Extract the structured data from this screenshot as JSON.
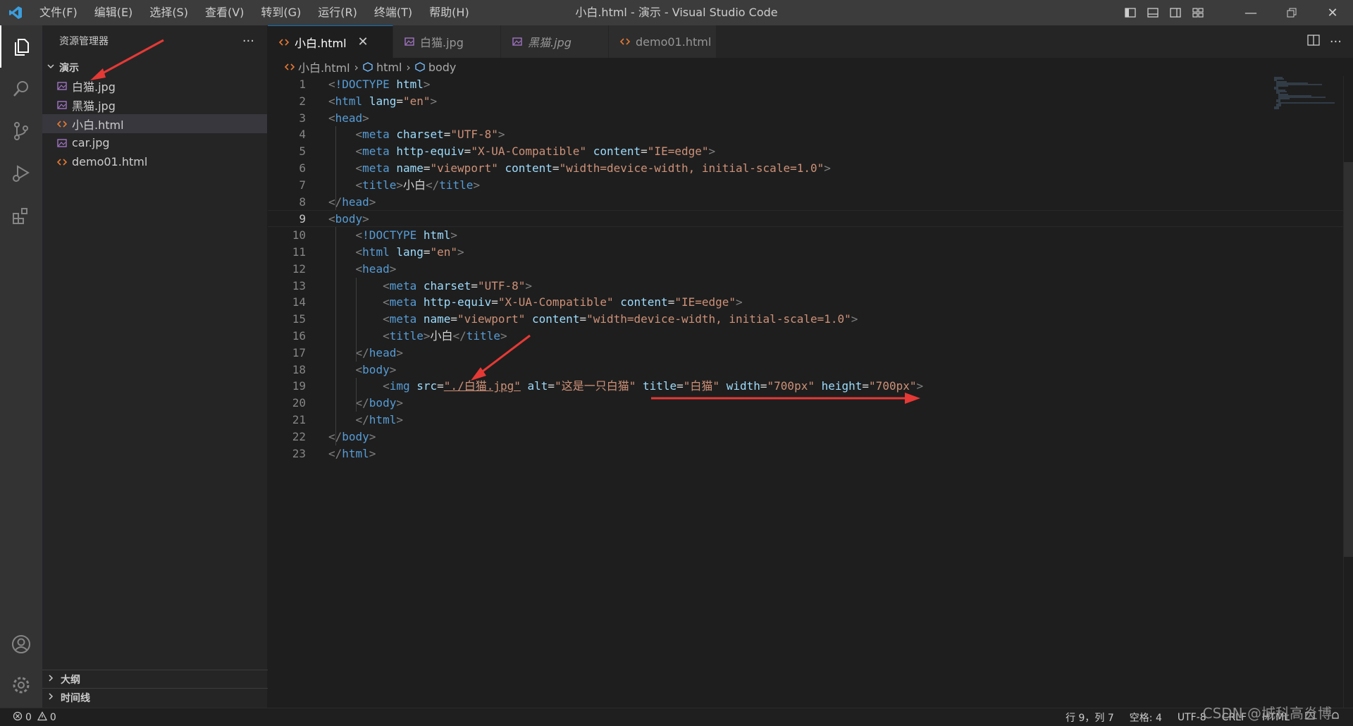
{
  "titlebar": {
    "menus": [
      "文件(F)",
      "编辑(E)",
      "选择(S)",
      "查看(V)",
      "转到(G)",
      "运行(R)",
      "终端(T)",
      "帮助(H)"
    ],
    "title": "小白.html - 演示 - Visual Studio Code"
  },
  "sidebar": {
    "header": "资源管理器",
    "more": "···",
    "folder": "演示",
    "files": [
      {
        "name": "白猫.jpg",
        "type": "image"
      },
      {
        "name": "黑猫.jpg",
        "type": "image"
      },
      {
        "name": "小白.html",
        "type": "html",
        "selected": true
      },
      {
        "name": "car.jpg",
        "type": "image"
      },
      {
        "name": "demo01.html",
        "type": "html"
      }
    ],
    "outline": "大纲",
    "timeline": "时间线"
  },
  "tabs": [
    {
      "label": "小白.html",
      "type": "html",
      "active": true
    },
    {
      "label": "白猫.jpg",
      "type": "image"
    },
    {
      "label": "黑猫.jpg",
      "type": "image",
      "italic": true
    },
    {
      "label": "demo01.html",
      "type": "html"
    }
  ],
  "breadcrumb": [
    "小白.html",
    "html",
    "body"
  ],
  "code_lines": [
    "<!DOCTYPE html>",
    "<html lang=\"en\">",
    "<head>",
    "    <meta charset=\"UTF-8\">",
    "    <meta http-equiv=\"X-UA-Compatible\" content=\"IE=edge\">",
    "    <meta name=\"viewport\" content=\"width=device-width, initial-scale=1.0\">",
    "    <title>小白</title>",
    "</head>",
    "<body>",
    "    <!DOCTYPE html>",
    "    <html lang=\"en\">",
    "    <head>",
    "        <meta charset=\"UTF-8\">",
    "        <meta http-equiv=\"X-UA-Compatible\" content=\"IE=edge\">",
    "        <meta name=\"viewport\" content=\"width=device-width, initial-scale=1.0\">",
    "        <title>小白</title>",
    "    </head>",
    "    <body>",
    "        <img src=\"./白猫.jpg\" alt=\"这是一只白猫\" title=\"白猫\" width=\"700px\" height=\"700px\">",
    "    </body>",
    "    </html>",
    "</body>",
    "</html>"
  ],
  "current_line": 9,
  "statusbar": {
    "errors": "0",
    "warnings": "0",
    "position": "行 9，列 7",
    "spaces": "空格: 4",
    "encoding": "UTF-8",
    "eol": "CRLF",
    "language": "HTML"
  },
  "watermark": "CSDN @城科高炎博",
  "colors": {
    "accent": "#0e70c0",
    "arrow": "#e53935"
  }
}
